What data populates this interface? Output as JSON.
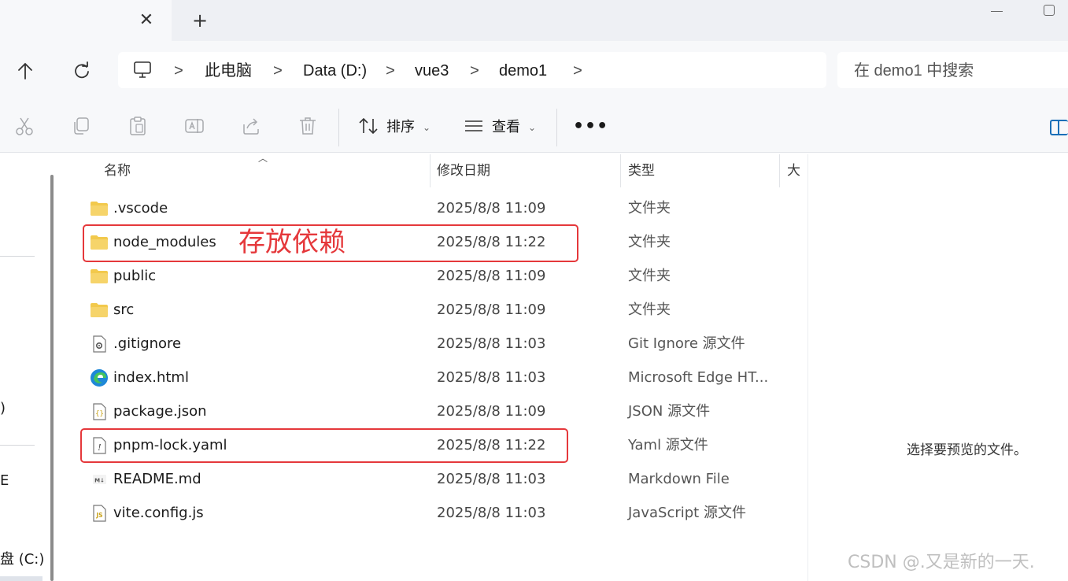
{
  "address_bar": {
    "breadcrumbs": [
      "此电脑",
      "Data (D:)",
      "vue3",
      "demo1"
    ],
    "separator": ">"
  },
  "search": {
    "placeholder": "在 demo1 中搜索"
  },
  "titlebar": {
    "close_tab": "✕",
    "new_tab": "+"
  },
  "toolbar": {
    "sort_label": "排序",
    "view_label": "查看",
    "more_label": "•••"
  },
  "columns": {
    "name": "名称",
    "date": "修改日期",
    "type": "类型",
    "size": "大小"
  },
  "files": [
    {
      "name": ".vscode",
      "date": "2025/8/8 11:09",
      "type": "文件夹",
      "icon": "folder-icon"
    },
    {
      "name": "node_modules",
      "date": "2025/8/8 11:22",
      "type": "文件夹",
      "icon": "folder-icon"
    },
    {
      "name": "public",
      "date": "2025/8/8 11:09",
      "type": "文件夹",
      "icon": "folder-icon"
    },
    {
      "name": "src",
      "date": "2025/8/8 11:09",
      "type": "文件夹",
      "icon": "folder-icon"
    },
    {
      "name": ".gitignore",
      "date": "2025/8/8 11:03",
      "type": "Git Ignore 源文件",
      "icon": "gear-file-icon"
    },
    {
      "name": "index.html",
      "date": "2025/8/8 11:03",
      "type": "Microsoft Edge HT...",
      "icon": "edge-icon"
    },
    {
      "name": "package.json",
      "date": "2025/8/8 11:09",
      "type": "JSON 源文件",
      "icon": "json-file-icon"
    },
    {
      "name": "pnpm-lock.yaml",
      "date": "2025/8/8 11:22",
      "type": "Yaml 源文件",
      "icon": "yaml-file-icon"
    },
    {
      "name": "README.md",
      "date": "2025/8/8 11:03",
      "type": "Markdown File",
      "icon": "markdown-file-icon"
    },
    {
      "name": "vite.config.js",
      "date": "2025/8/8 11:03",
      "type": "JavaScript 源文件",
      "icon": "js-file-icon"
    }
  ],
  "annotation": {
    "text": "存放依赖",
    "color": "#e5383b"
  },
  "nav_pane": {
    "drive_label": "盘 (C:)",
    "fragment1": ")",
    "fragment2": "E"
  },
  "preview_pane": {
    "message": "选择要预览的文件。"
  },
  "watermark": "CSDN @.又是新的一天.",
  "colors": {
    "folder": "#f2c94c",
    "accent": "#1a6fb8",
    "annotation": "#e5383b"
  }
}
